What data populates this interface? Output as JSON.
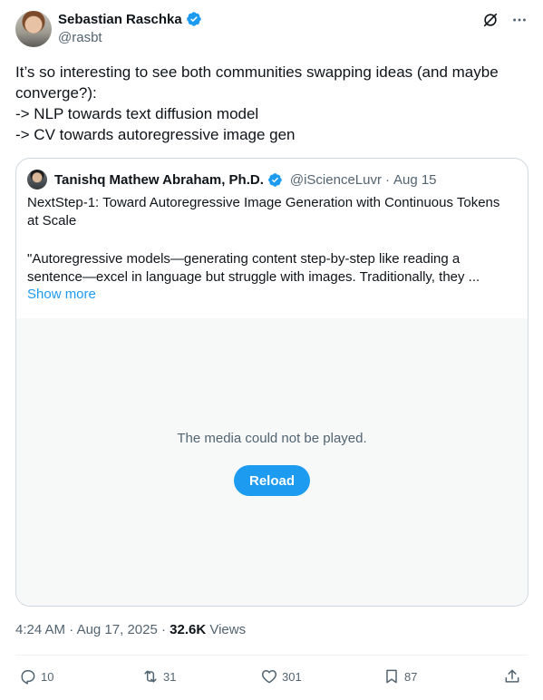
{
  "tweet": {
    "author_name": "Sebastian Raschka",
    "handle": "@rasbt",
    "text": "It’s so interesting to see both communities swapping ideas (and maybe\nconverge?):\n-> NLP towards text diffusion model\n-> CV towards autoregressive image gen"
  },
  "quote": {
    "author_name": "Tanishq Mathew Abraham, Ph.D.",
    "handle": "@iScienceLuvr",
    "separator": "·",
    "date": "Aug 15",
    "title": "NextStep-1: Toward Autoregressive Image Generation with Continuous Tokens\nat Scale",
    "excerpt": "\"Autoregressive models—generating content step-by-step like  reading a\nsentence—excel in language but struggle with images.  Traditionally, they ...",
    "show_more": "Show more",
    "media_message": "The media could not be played.",
    "reload_label": "Reload"
  },
  "meta": {
    "time": "4:24 AM",
    "separator": "·",
    "date": "Aug 17, 2025",
    "views_count": "32.6K",
    "views_label": "Views"
  },
  "actions": {
    "replies": "10",
    "reposts": "31",
    "likes": "301",
    "bookmarks": "87"
  },
  "icons": {
    "verified": "verified-badge-icon",
    "grok": "grok-icon",
    "more": "more-icon",
    "reply": "reply-icon",
    "repost": "repost-icon",
    "like": "heart-icon",
    "bookmark": "bookmark-icon",
    "share": "share-icon"
  },
  "colors": {
    "accent": "#1d9bf0",
    "muted": "#536471",
    "text": "#0f1419",
    "border": "#cfd9de",
    "media_bg": "#f7f9f9"
  }
}
